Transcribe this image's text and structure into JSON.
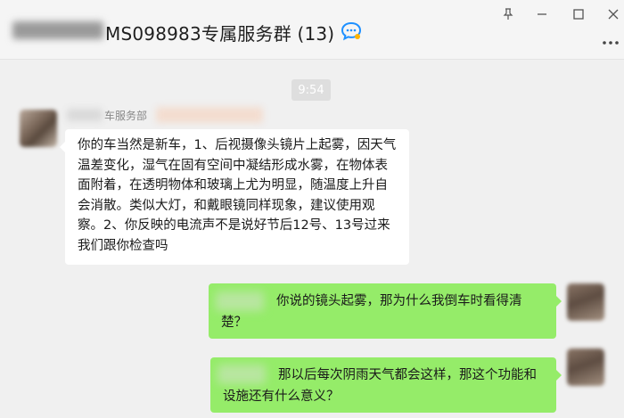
{
  "window": {
    "title": "MS098983专属服务群 (13)",
    "icons": {
      "chat": "chat-bubble-icon",
      "pin": "pin-icon",
      "minimize": "minimize-icon",
      "maximize": "maximize-icon",
      "close": "close-icon",
      "more": "more-icon"
    }
  },
  "chat": {
    "timestamp": "9:54",
    "incoming": {
      "sender": "车服务部",
      "text": "你的车当然是新车，1、后视摄像头镜片上起雾，因天气温差变化，湿气在固有空间中凝结形成水雾，在物体表面附着，在透明物体和玻璃上尤为明显，随温度上升自会消散。类似大灯，和戴眼镜同样现象，建议使用观察。2、你反映的电流声不是说好节后12号、13号过来我们跟你检查吗"
    },
    "outgoing": [
      {
        "text": "你说的镜头起雾，那为什么我倒车时看得清楚？"
      },
      {
        "text": "那以后每次阴雨天气都会这样，那这个功能和设施还有什么意义？"
      }
    ]
  },
  "colors": {
    "bubble_in": "#ffffff",
    "bubble_out": "#95ec69",
    "background": "#f0f0f0",
    "timestamp_bg": "#dedede",
    "accent": "#1e90ff"
  }
}
